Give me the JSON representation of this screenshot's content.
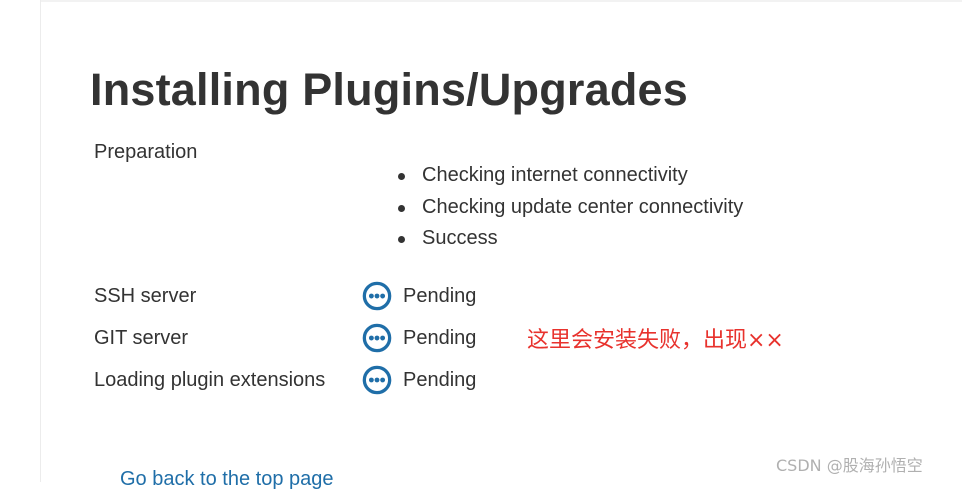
{
  "page": {
    "title": "Installing Plugins/Upgrades",
    "preparation": {
      "label": "Preparation",
      "checks": [
        "Checking internet connectivity",
        "Checking update center connectivity",
        "Success"
      ]
    },
    "plugins": [
      {
        "name": "SSH server",
        "status": "Pending",
        "icon": "pending-icon"
      },
      {
        "name": "GIT server",
        "status": "Pending",
        "icon": "pending-icon"
      },
      {
        "name": "Loading plugin extensions",
        "status": "Pending",
        "icon": "pending-icon"
      }
    ],
    "back_link": "Go back to the top page"
  },
  "annotation": "这里会安装失败，出现××",
  "watermark": "CSDN @股海孙悟空",
  "colors": {
    "text": "#333333",
    "pending_icon": "#1f6ea8",
    "annotation": "#e8322d",
    "link": "#1f6ea8"
  }
}
